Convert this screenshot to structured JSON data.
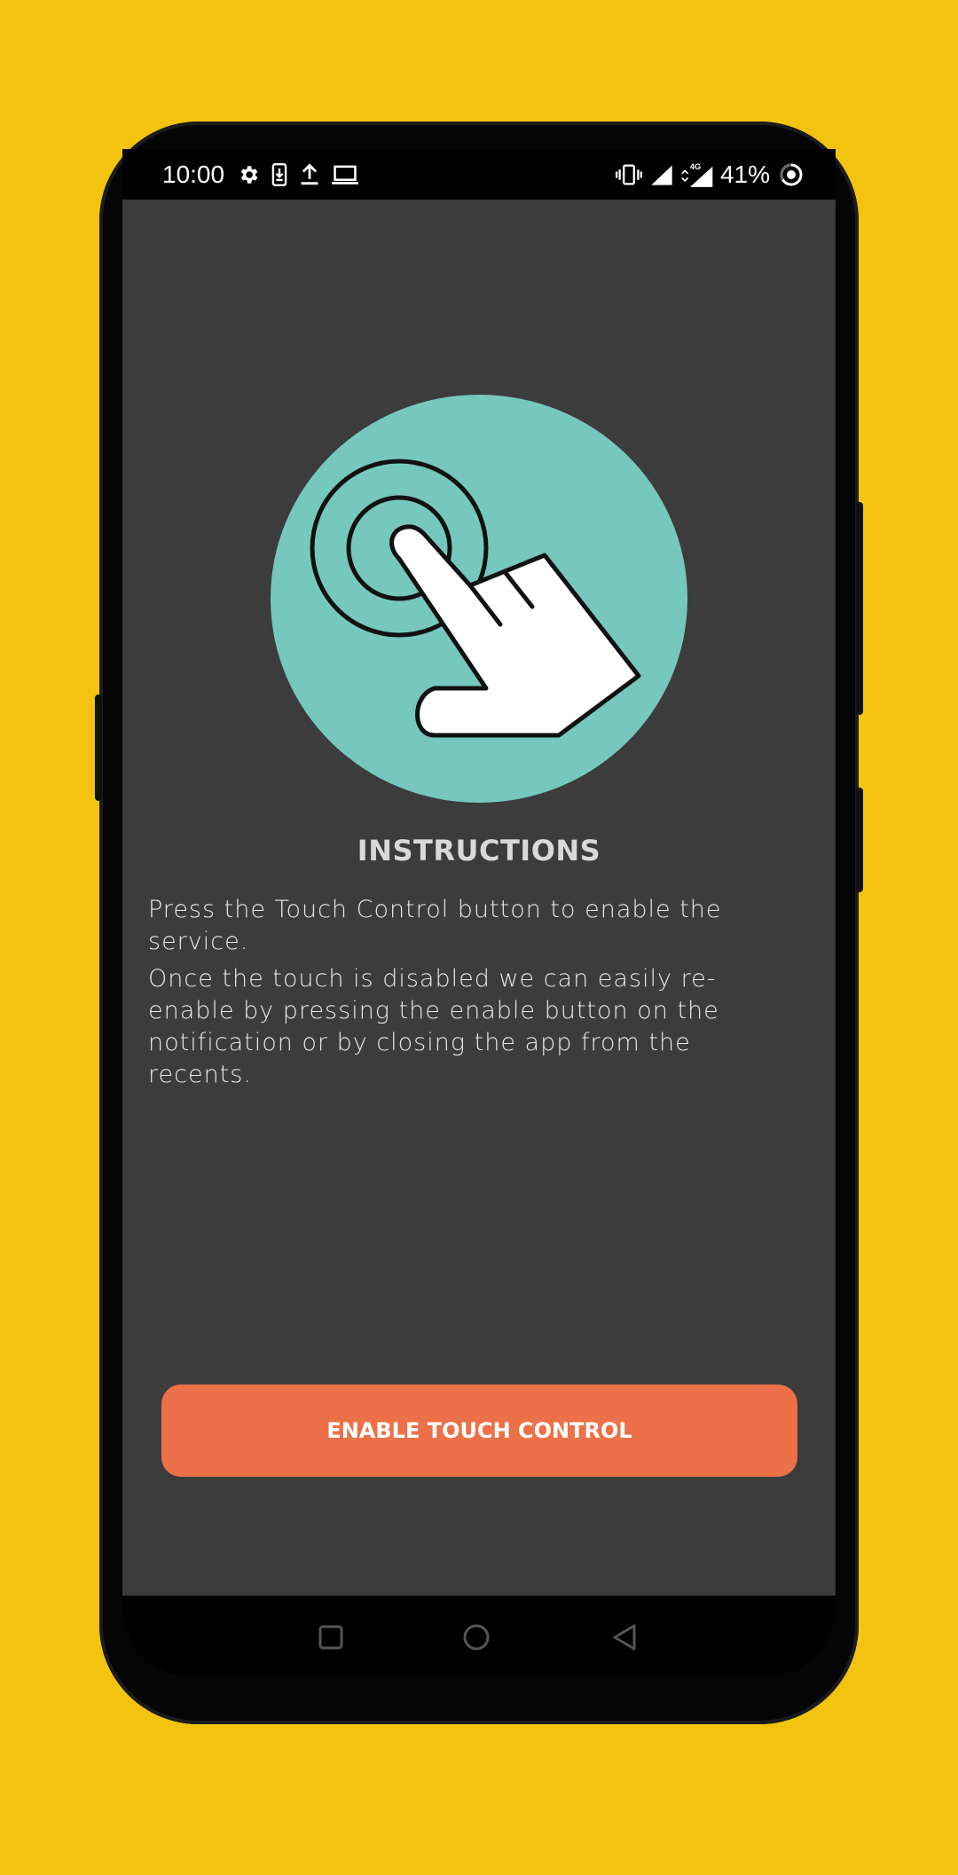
{
  "status_bar": {
    "time": "10:00",
    "battery": "41%",
    "left_icons": [
      "settings-icon",
      "download-icon",
      "upload-icon",
      "laptop-icon"
    ],
    "right_icons": [
      "vibrate-icon",
      "signal-icon",
      "lte-signal-icon",
      "battery-ring-icon"
    ],
    "network_label": "4G"
  },
  "main": {
    "hero_icon": "touch-hand-icon",
    "title": "INSTRUCTIONS",
    "paragraphs": [
      "Press the Touch Control button to enable the service.",
      "Once the touch is disabled we can easily re-enable by pressing the enable button on the notification or by closing the app from the recents."
    ],
    "enable_button_label": "ENABLE TOUCH CONTROL"
  },
  "navigation": {
    "buttons": [
      "recents-icon",
      "home-icon",
      "back-icon"
    ]
  },
  "colors": {
    "background": "#F2C410",
    "app_background": "#3C3C3C",
    "accent": "#EC7148",
    "hero_circle": "#76C8BC"
  }
}
